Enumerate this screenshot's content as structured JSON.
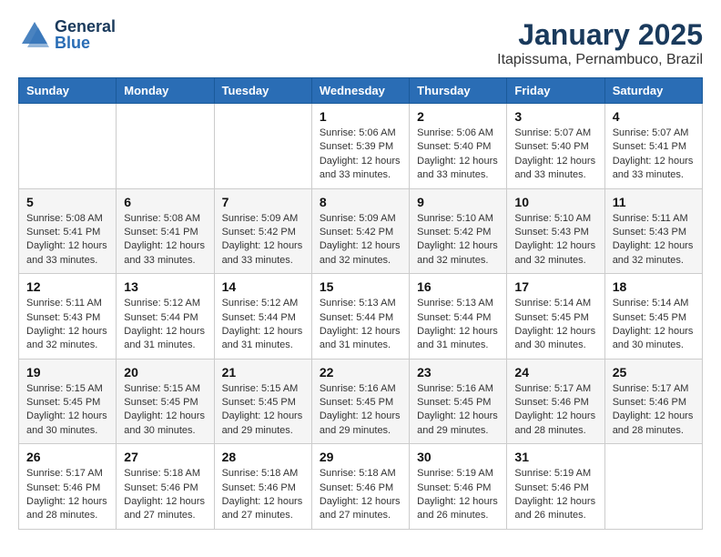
{
  "header": {
    "logo_general": "General",
    "logo_blue": "Blue",
    "month_title": "January 2025",
    "location": "Itapissuma, Pernambuco, Brazil"
  },
  "days_of_week": [
    "Sunday",
    "Monday",
    "Tuesday",
    "Wednesday",
    "Thursday",
    "Friday",
    "Saturday"
  ],
  "weeks": [
    {
      "days": [
        {
          "date": "",
          "info": ""
        },
        {
          "date": "",
          "info": ""
        },
        {
          "date": "",
          "info": ""
        },
        {
          "date": "1",
          "info": "Sunrise: 5:06 AM\nSunset: 5:39 PM\nDaylight: 12 hours\nand 33 minutes."
        },
        {
          "date": "2",
          "info": "Sunrise: 5:06 AM\nSunset: 5:40 PM\nDaylight: 12 hours\nand 33 minutes."
        },
        {
          "date": "3",
          "info": "Sunrise: 5:07 AM\nSunset: 5:40 PM\nDaylight: 12 hours\nand 33 minutes."
        },
        {
          "date": "4",
          "info": "Sunrise: 5:07 AM\nSunset: 5:41 PM\nDaylight: 12 hours\nand 33 minutes."
        }
      ]
    },
    {
      "days": [
        {
          "date": "5",
          "info": "Sunrise: 5:08 AM\nSunset: 5:41 PM\nDaylight: 12 hours\nand 33 minutes."
        },
        {
          "date": "6",
          "info": "Sunrise: 5:08 AM\nSunset: 5:41 PM\nDaylight: 12 hours\nand 33 minutes."
        },
        {
          "date": "7",
          "info": "Sunrise: 5:09 AM\nSunset: 5:42 PM\nDaylight: 12 hours\nand 33 minutes."
        },
        {
          "date": "8",
          "info": "Sunrise: 5:09 AM\nSunset: 5:42 PM\nDaylight: 12 hours\nand 32 minutes."
        },
        {
          "date": "9",
          "info": "Sunrise: 5:10 AM\nSunset: 5:42 PM\nDaylight: 12 hours\nand 32 minutes."
        },
        {
          "date": "10",
          "info": "Sunrise: 5:10 AM\nSunset: 5:43 PM\nDaylight: 12 hours\nand 32 minutes."
        },
        {
          "date": "11",
          "info": "Sunrise: 5:11 AM\nSunset: 5:43 PM\nDaylight: 12 hours\nand 32 minutes."
        }
      ]
    },
    {
      "days": [
        {
          "date": "12",
          "info": "Sunrise: 5:11 AM\nSunset: 5:43 PM\nDaylight: 12 hours\nand 32 minutes."
        },
        {
          "date": "13",
          "info": "Sunrise: 5:12 AM\nSunset: 5:44 PM\nDaylight: 12 hours\nand 31 minutes."
        },
        {
          "date": "14",
          "info": "Sunrise: 5:12 AM\nSunset: 5:44 PM\nDaylight: 12 hours\nand 31 minutes."
        },
        {
          "date": "15",
          "info": "Sunrise: 5:13 AM\nSunset: 5:44 PM\nDaylight: 12 hours\nand 31 minutes."
        },
        {
          "date": "16",
          "info": "Sunrise: 5:13 AM\nSunset: 5:44 PM\nDaylight: 12 hours\nand 31 minutes."
        },
        {
          "date": "17",
          "info": "Sunrise: 5:14 AM\nSunset: 5:45 PM\nDaylight: 12 hours\nand 30 minutes."
        },
        {
          "date": "18",
          "info": "Sunrise: 5:14 AM\nSunset: 5:45 PM\nDaylight: 12 hours\nand 30 minutes."
        }
      ]
    },
    {
      "days": [
        {
          "date": "19",
          "info": "Sunrise: 5:15 AM\nSunset: 5:45 PM\nDaylight: 12 hours\nand 30 minutes."
        },
        {
          "date": "20",
          "info": "Sunrise: 5:15 AM\nSunset: 5:45 PM\nDaylight: 12 hours\nand 30 minutes."
        },
        {
          "date": "21",
          "info": "Sunrise: 5:15 AM\nSunset: 5:45 PM\nDaylight: 12 hours\nand 29 minutes."
        },
        {
          "date": "22",
          "info": "Sunrise: 5:16 AM\nSunset: 5:45 PM\nDaylight: 12 hours\nand 29 minutes."
        },
        {
          "date": "23",
          "info": "Sunrise: 5:16 AM\nSunset: 5:45 PM\nDaylight: 12 hours\nand 29 minutes."
        },
        {
          "date": "24",
          "info": "Sunrise: 5:17 AM\nSunset: 5:46 PM\nDaylight: 12 hours\nand 28 minutes."
        },
        {
          "date": "25",
          "info": "Sunrise: 5:17 AM\nSunset: 5:46 PM\nDaylight: 12 hours\nand 28 minutes."
        }
      ]
    },
    {
      "days": [
        {
          "date": "26",
          "info": "Sunrise: 5:17 AM\nSunset: 5:46 PM\nDaylight: 12 hours\nand 28 minutes."
        },
        {
          "date": "27",
          "info": "Sunrise: 5:18 AM\nSunset: 5:46 PM\nDaylight: 12 hours\nand 27 minutes."
        },
        {
          "date": "28",
          "info": "Sunrise: 5:18 AM\nSunset: 5:46 PM\nDaylight: 12 hours\nand 27 minutes."
        },
        {
          "date": "29",
          "info": "Sunrise: 5:18 AM\nSunset: 5:46 PM\nDaylight: 12 hours\nand 27 minutes."
        },
        {
          "date": "30",
          "info": "Sunrise: 5:19 AM\nSunset: 5:46 PM\nDaylight: 12 hours\nand 26 minutes."
        },
        {
          "date": "31",
          "info": "Sunrise: 5:19 AM\nSunset: 5:46 PM\nDaylight: 12 hours\nand 26 minutes."
        },
        {
          "date": "",
          "info": ""
        }
      ]
    }
  ]
}
